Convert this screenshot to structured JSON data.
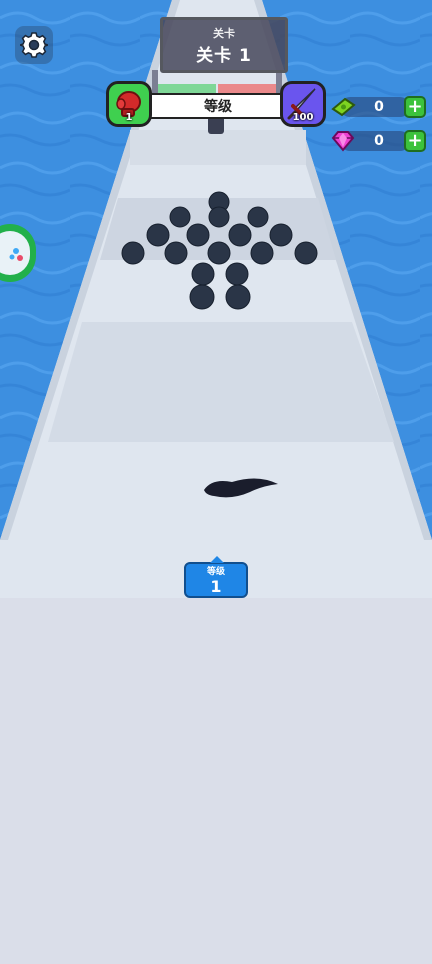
{
  "level_plate": {
    "sub_label": "关卡",
    "title": "关卡 1"
  },
  "weapon_progress": {
    "label": "等级",
    "start_level": "1",
    "target_level": "100",
    "progress_fraction": 0.0
  },
  "currencies": {
    "cash": {
      "value": "0",
      "icon": "cash-icon",
      "add_label": "+"
    },
    "gems": {
      "value": "0",
      "icon": "gem-icon",
      "add_label": "+"
    }
  },
  "player": {
    "level_label": "等级",
    "level_value": "1"
  },
  "icons": {
    "settings": "gear-icon",
    "left_weapon": "boxing-glove-icon",
    "right_weapon": "sword-icon"
  },
  "colors": {
    "water": "#3d8fe0",
    "track": "#dfe6ef",
    "balls": "#2a3547",
    "badge": "#1f86e6",
    "plus": "#3cc23c"
  }
}
